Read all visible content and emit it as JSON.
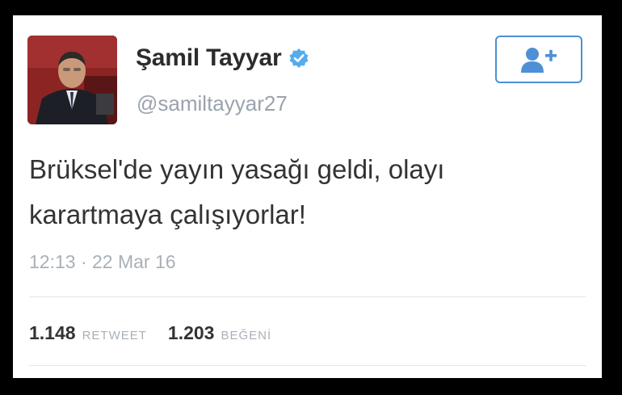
{
  "user": {
    "name": "Şamil Tayyar",
    "handle": "@samiltayyar27",
    "verified": true
  },
  "tweet": {
    "text": "Brüksel'de yayın yasağı geldi, olayı\nkarartmaya çalışıyorlar!",
    "timestamp": "12:13 · 22 Mar 16"
  },
  "stats": {
    "retweets": {
      "count": "1.148",
      "label": "RETWEET"
    },
    "likes": {
      "count": "1.203",
      "label": "BEĞENİ"
    }
  },
  "icons": {
    "follow": "add-user-icon",
    "verified": "verified-badge-icon"
  },
  "colors": {
    "accent": "#4d90d6",
    "verified": "#55acee",
    "muted": "#a8b0b8",
    "text": "#333333"
  }
}
